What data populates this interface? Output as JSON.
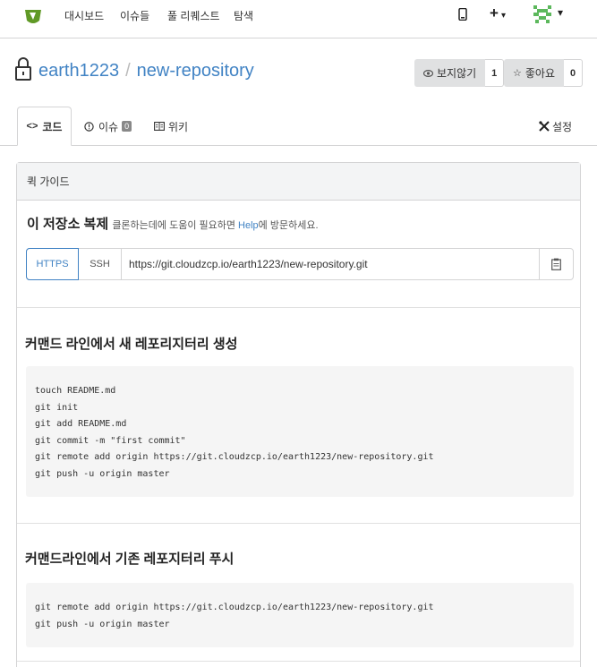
{
  "nav": {
    "items": [
      {
        "label": "대시보드"
      },
      {
        "label": "이슈들"
      },
      {
        "label": "풀 리퀘스트"
      },
      {
        "label": "탐색"
      }
    ],
    "plus_label": "+",
    "logo": "gitea-tea-icon",
    "mobile_icon": "mobile-icon",
    "caret": "▾"
  },
  "repo": {
    "owner": "earth1223",
    "separator": "/",
    "name": "new-repository",
    "watch_label": "보지않기",
    "watch_count": "1",
    "star_label": "좋아요",
    "star_count": "0"
  },
  "tabs": [
    {
      "label": "코드",
      "active": true
    },
    {
      "label": "이슈",
      "badge": "0"
    },
    {
      "label": "위키"
    },
    {
      "label": "설정"
    }
  ],
  "quick_guide": {
    "header": "퀵 가이드",
    "clone_title": "이 저장소 복제",
    "clone_help_before": "클론하는데에 도움이 필요하면 ",
    "clone_help_link": "Help",
    "clone_help_after": "에 방문하세요.",
    "protocols": [
      "HTTPS",
      "SSH"
    ],
    "clone_url": "https://git.cloudzcp.io/earth1223/new-repository.git"
  },
  "sections": [
    {
      "title": "커맨드 라인에서 새 레포리지터리 생성",
      "code": [
        "touch README.md",
        "git init",
        "git add README.md",
        "git commit -m \"first commit\"",
        "git remote add origin https://git.cloudzcp.io/earth1223/new-repository.git",
        "git push -u origin master"
      ]
    },
    {
      "title": "커맨드라인에서 기존 레포지터리 푸시",
      "code": [
        "git remote add origin https://git.cloudzcp.io/earth1223/new-repository.git",
        "git push -u origin master"
      ]
    }
  ],
  "colors": {
    "link": "#4183c4",
    "logo_green": "#609926"
  }
}
